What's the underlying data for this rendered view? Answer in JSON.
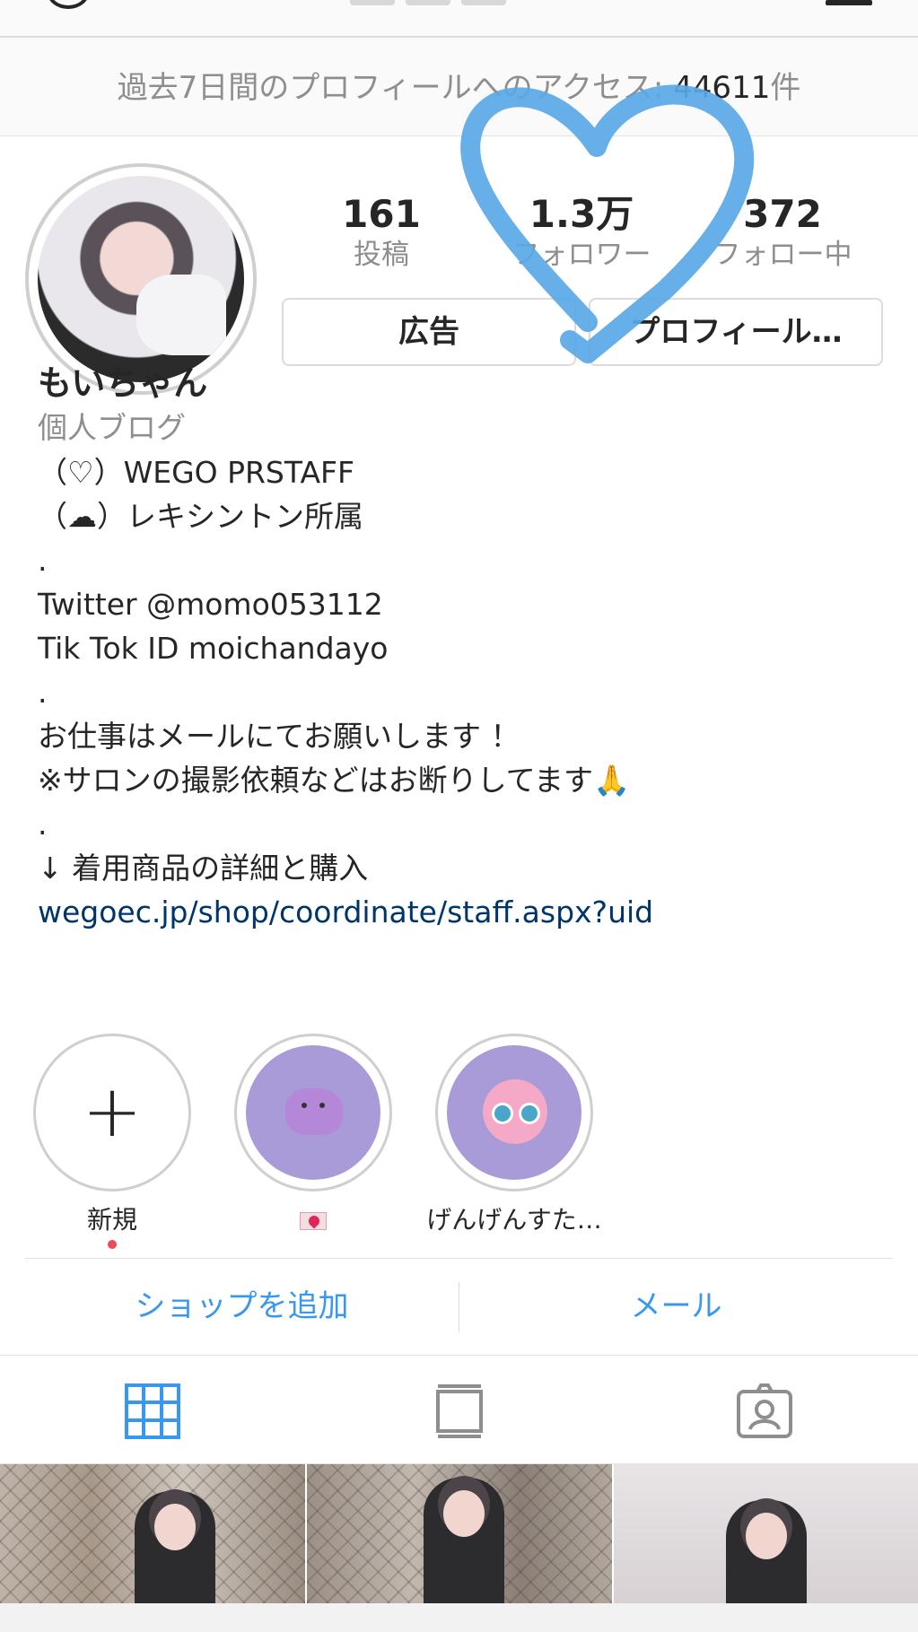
{
  "insights": {
    "label": "過去7日間のプロフィールへのアクセス: ",
    "count": "44611",
    "suffix": "件"
  },
  "stats": {
    "posts": {
      "value": "161",
      "label": "投稿"
    },
    "followers": {
      "value": "1.3万",
      "label": "フォロワー"
    },
    "following": {
      "value": "372",
      "label": "フォロー中"
    }
  },
  "buttons": {
    "ad": "広告",
    "edit_profile": "プロフィール…"
  },
  "bio": {
    "name": "もいちゃん",
    "category": "個人ブログ",
    "lines": [
      "（♡）WEGO PRSTAFF",
      "（☁）レキシントン所属",
      ".",
      "Twitter @momo053112",
      "Tik Tok ID moichandayo",
      ".",
      "お仕事はメールにてお願いします ！",
      "※サロンの撮影依頼などはお断りしてます🙏",
      ".",
      "↓ 着用商品の詳細と購入"
    ],
    "link": "wegoec.jp/shop/coordinate/staff.aspx?uid"
  },
  "highlights": [
    {
      "label": "新規",
      "icon": "plus-icon"
    },
    {
      "label": "",
      "icon": "envelope-heart-icon"
    },
    {
      "label": "げんげんすた…",
      "icon": "pink-puff-icon"
    }
  ],
  "contact": {
    "shop": "ショップを追加",
    "mail": "メール"
  },
  "tabs": [
    {
      "icon": "grid-icon",
      "active": true
    },
    {
      "icon": "feed-icon",
      "active": false
    },
    {
      "icon": "tagged-icon",
      "active": false
    }
  ],
  "colors": {
    "accent": "#3897f0",
    "link": "#003569",
    "heart_overlay": "#5aa8e6",
    "notification_dot": "#ed4956"
  }
}
